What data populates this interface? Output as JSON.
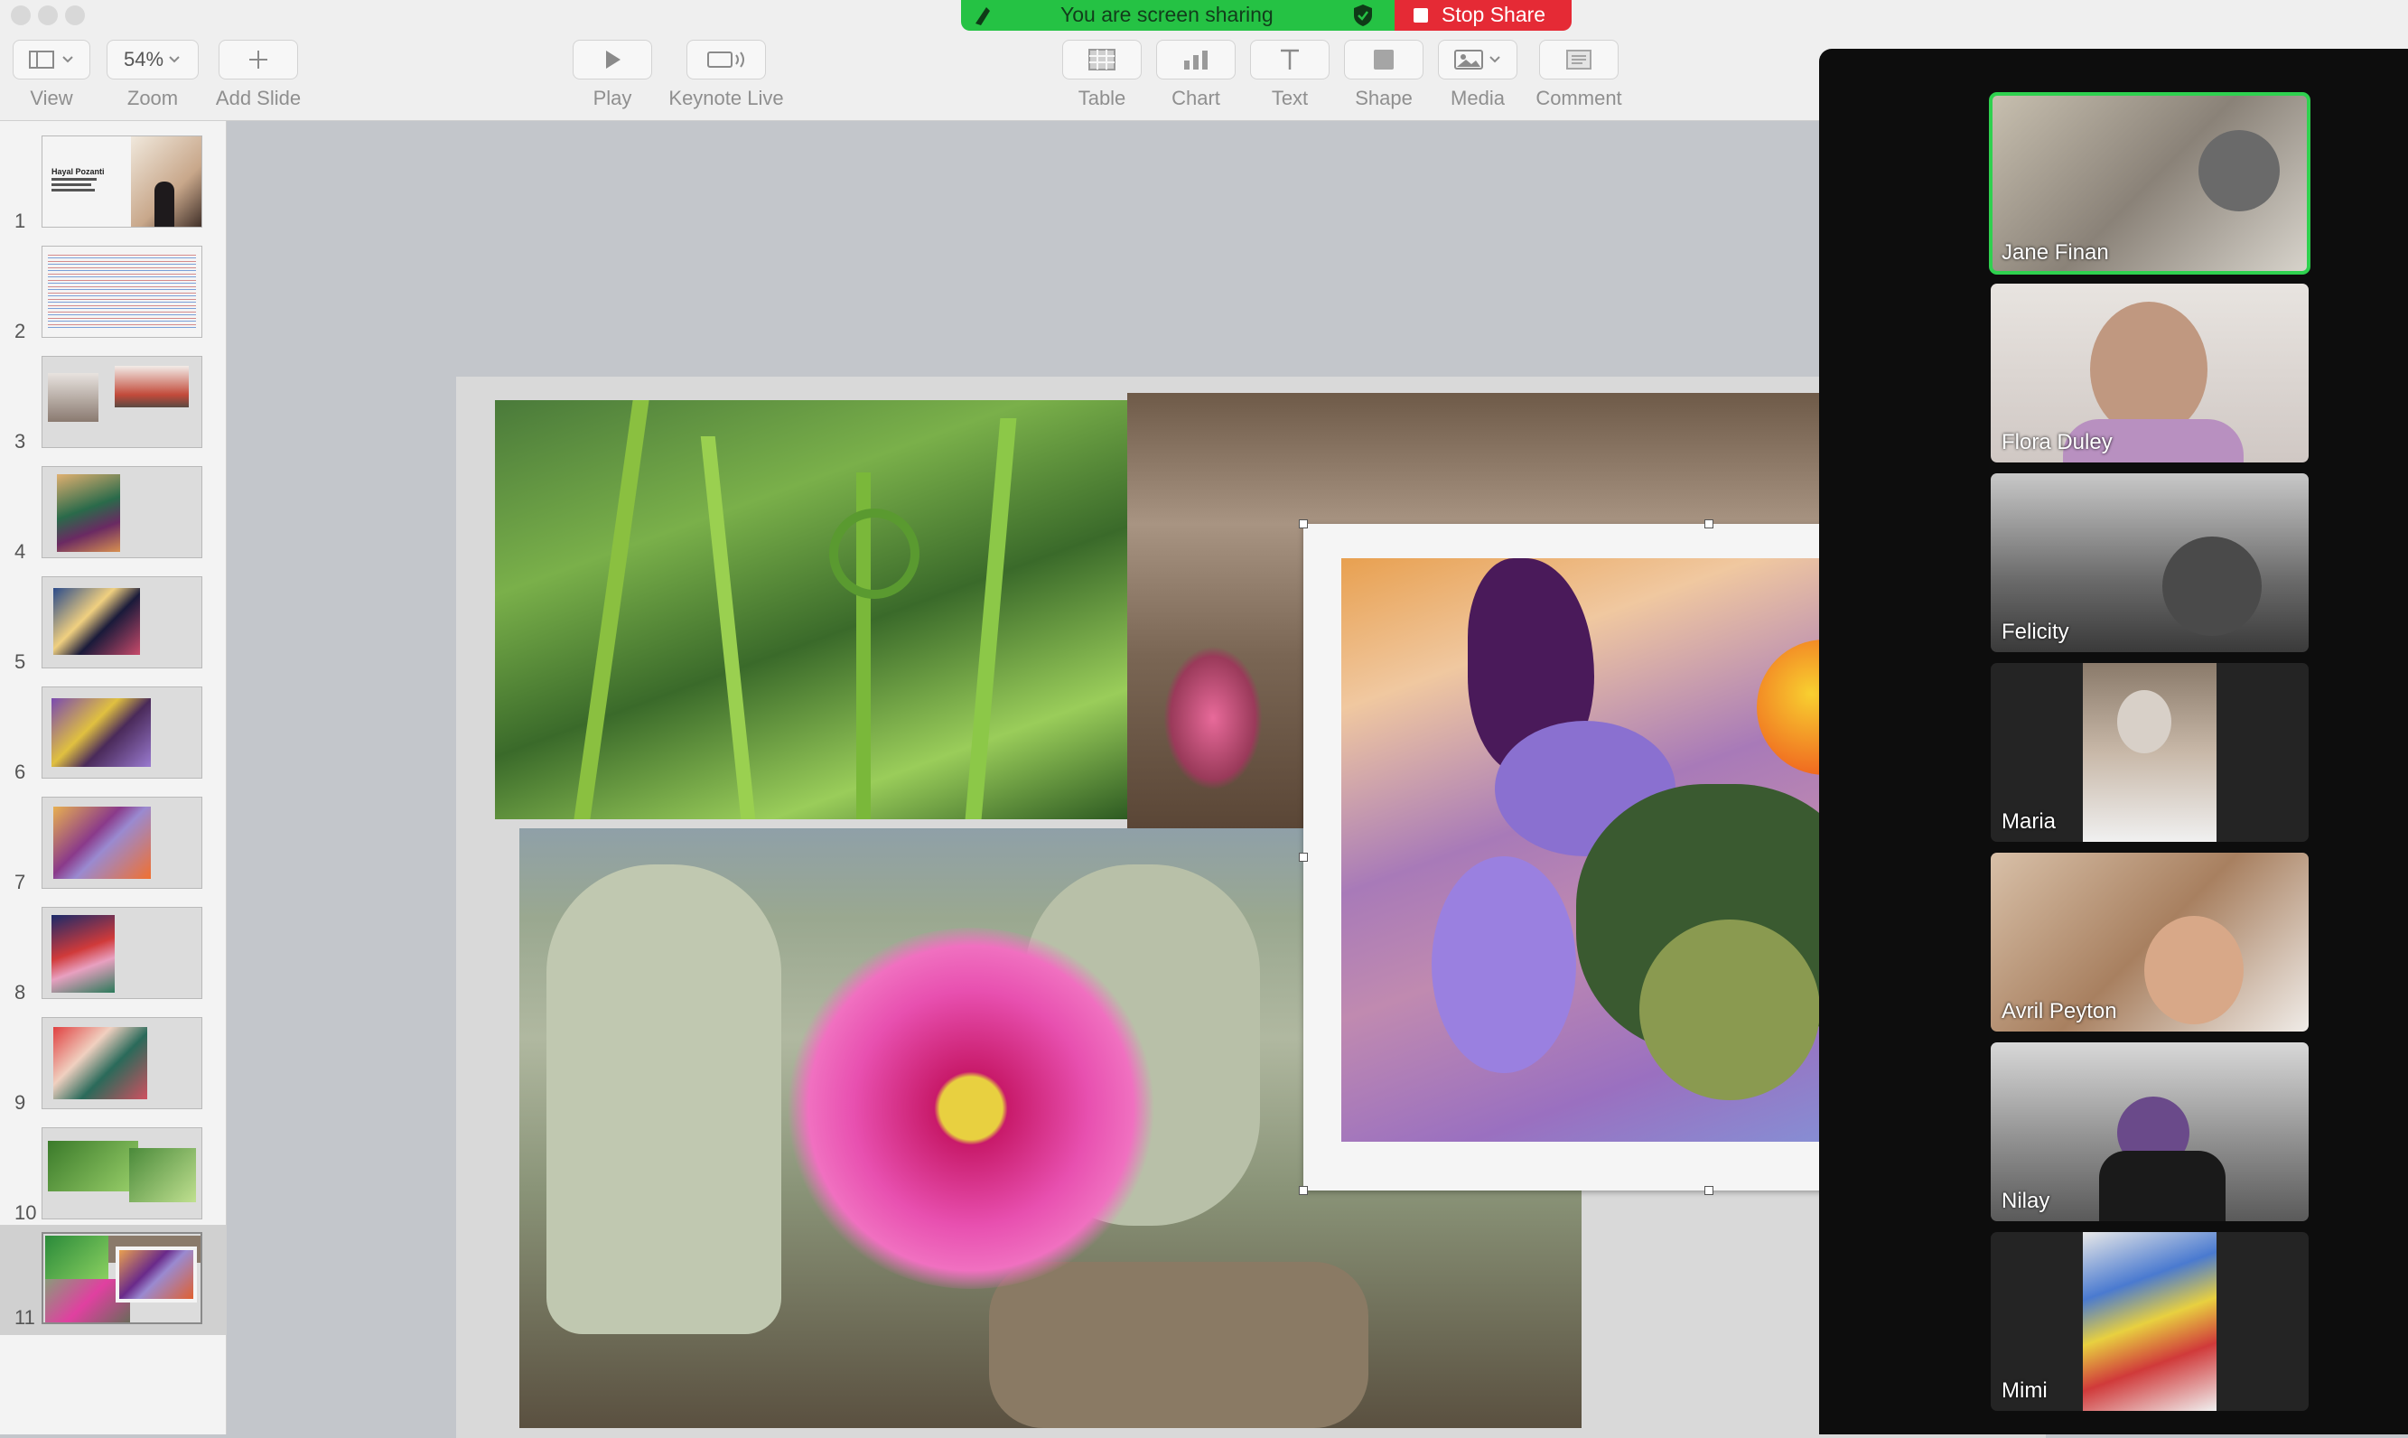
{
  "toolbar": {
    "zoom_value": "54%",
    "view_label": "View",
    "zoom_label": "Zoom",
    "add_slide_label": "Add Slide",
    "play_label": "Play",
    "keynote_live_label": "Keynote Live",
    "table_label": "Table",
    "chart_label": "Chart",
    "text_label": "Text",
    "shape_label": "Shape",
    "media_label": "Media",
    "comment_label": "Comment"
  },
  "screen_share": {
    "status_text": "You are screen sharing",
    "stop_label": "Stop Share",
    "green": "#25c244",
    "red": "#e52a35"
  },
  "navigator": {
    "selected_slide": 11,
    "slides": [
      {
        "number": "1",
        "title": "Hayal Pozanti"
      },
      {
        "number": "2"
      },
      {
        "number": "3"
      },
      {
        "number": "4"
      },
      {
        "number": "5"
      },
      {
        "number": "6"
      },
      {
        "number": "7"
      },
      {
        "number": "8"
      },
      {
        "number": "9"
      },
      {
        "number": "10"
      },
      {
        "number": "11"
      }
    ]
  },
  "gallery": {
    "active_speaker_color": "#2fd14f",
    "participants": [
      {
        "name": "Jane Finan"
      },
      {
        "name": "Flora Duley"
      },
      {
        "name": "Felicity"
      },
      {
        "name": "Maria"
      },
      {
        "name": "Avril Peyton"
      },
      {
        "name": "Nilay"
      },
      {
        "name": "Mimi"
      }
    ]
  },
  "icons": {
    "view": "sidebar-layout-icon",
    "zoom": "chevron-down-icon",
    "add_slide": "plus-icon",
    "play": "play-icon",
    "keynote_live": "broadcast-icon",
    "table": "table-grid-icon",
    "chart": "bar-chart-icon",
    "text": "text-t-icon",
    "shape": "square-icon",
    "media": "image-icon",
    "comment": "comment-icon",
    "share": "shield-check-icon",
    "stop": "stop-square-icon"
  }
}
